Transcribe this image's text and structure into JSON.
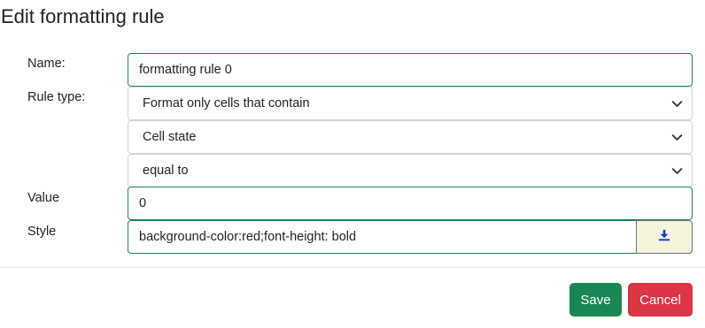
{
  "dialog": {
    "title": "Edit formatting rule"
  },
  "form": {
    "name_label": "Name:",
    "name_value": "formatting rule 0",
    "rule_type_label": "Rule type:",
    "rule_type_selected": "Format only cells that contain",
    "condition_subject_selected": "Cell state",
    "operator_selected": "equal to",
    "value_label": "Value",
    "value_value": "0",
    "style_label": "Style",
    "style_value": "background-color:red;font-height: bold"
  },
  "icons": {
    "select_chevron": "chevron-down-icon",
    "style_picker": "download-icon"
  },
  "footer": {
    "save_label": "Save",
    "cancel_label": "Cancel"
  },
  "colors": {
    "valid_border": "#198754",
    "save_button": "#198754",
    "cancel_button": "#dc3545",
    "style_button_bg": "#f5f5dc",
    "icon_blue": "#0d3fd6"
  }
}
